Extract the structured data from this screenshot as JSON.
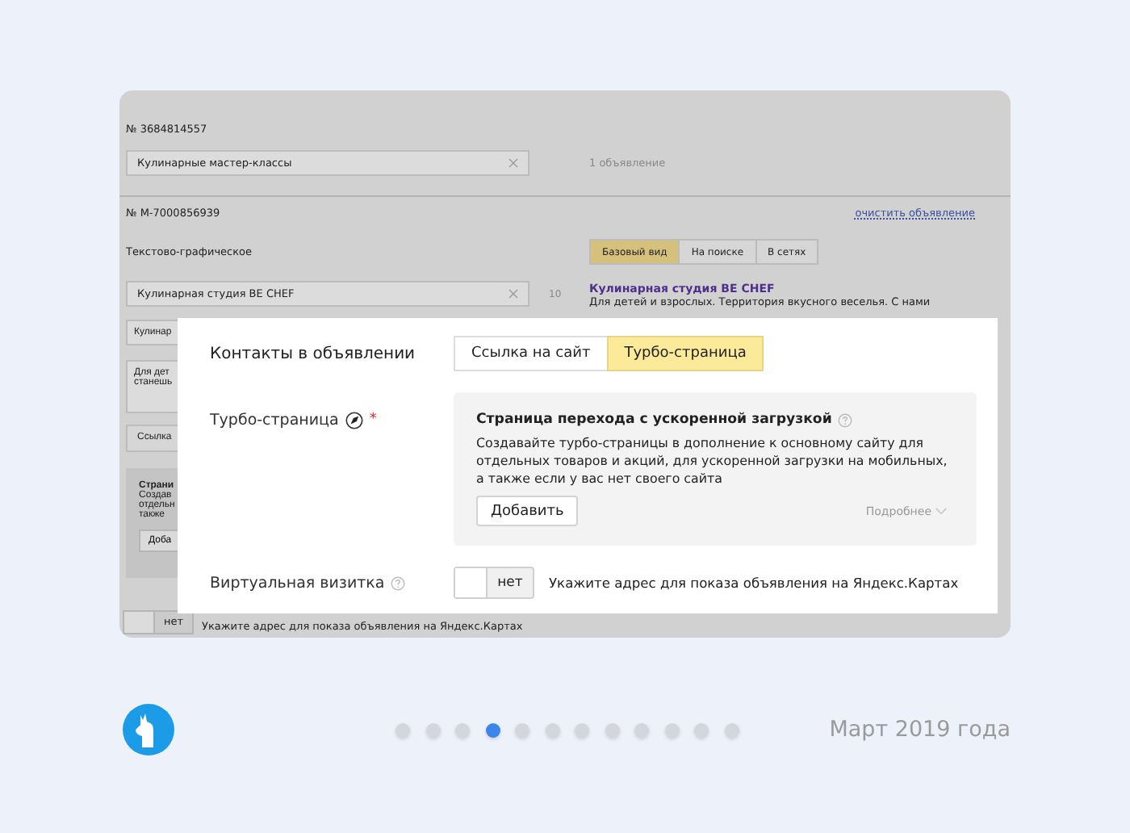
{
  "background_screen": {
    "campaign": {
      "number": "№ 3684814557",
      "name_field": "Кулинарные мастер-классы",
      "ads_count": "1 объявление"
    },
    "ad": {
      "number": "№ М-7000856939",
      "clear_link": "очистить объявление",
      "type": "Текстово-графическое",
      "view_tabs": [
        {
          "label": "Базовый вид",
          "selected": true
        },
        {
          "label": "На поиске",
          "selected": false
        },
        {
          "label": "В сетях",
          "selected": false
        }
      ],
      "title_field": "Кулинарная студия BE CHEF",
      "title_counter": "10",
      "preview_title": "Кулинарная студия BE CHEF",
      "preview_text": "Для детей и взрослых. Территория вкусного веселья. С нами"
    },
    "covered": {
      "field": "Кулинар",
      "textarea_lines": [
        "Для дет",
        "станешь"
      ],
      "select": "Ссылка",
      "turbo_box": {
        "title": "Страни",
        "lines": [
          "Создав",
          "отдельн",
          "также"
        ],
        "button": "Доба"
      }
    },
    "vcard": {
      "toggle": {
        "label": "нет",
        "on": false
      },
      "hint": "Укажите адрес для показа объявления на Яндекс.Картах"
    }
  },
  "popup": {
    "title": "Контакты в объявлении",
    "link_options": [
      {
        "label": "Ссылка на сайт",
        "selected": false
      },
      {
        "label": "Турбо-страница",
        "selected": true
      }
    ],
    "turbo": {
      "label": "Турбо-страница",
      "required_mark": "*",
      "box": {
        "title": "Страница перехода с ускоренной загрузкой",
        "description": "Создавайте турбо-страницы в дополнение к основному сайту для отдельных товаров и акций, для ускоренной загрузки на мобильных, а также если у вас нет своего сайта",
        "add_button": "Добавить",
        "more_link": "Подробнее"
      }
    },
    "vcard": {
      "label": "Виртуальная визитка",
      "toggle": {
        "label": "нет",
        "on": false
      },
      "hint": "Укажите адрес для показа объявления на Яндекс.Картах"
    }
  },
  "footer": {
    "pager": [
      {
        "selected": false
      },
      {
        "selected": false
      },
      {
        "selected": false
      },
      {
        "selected": true
      },
      {
        "selected": false
      },
      {
        "selected": false
      },
      {
        "selected": false
      },
      {
        "selected": false
      },
      {
        "selected": false
      },
      {
        "selected": false
      },
      {
        "selected": false
      },
      {
        "selected": false
      }
    ],
    "date": "Март 2019 года"
  }
}
